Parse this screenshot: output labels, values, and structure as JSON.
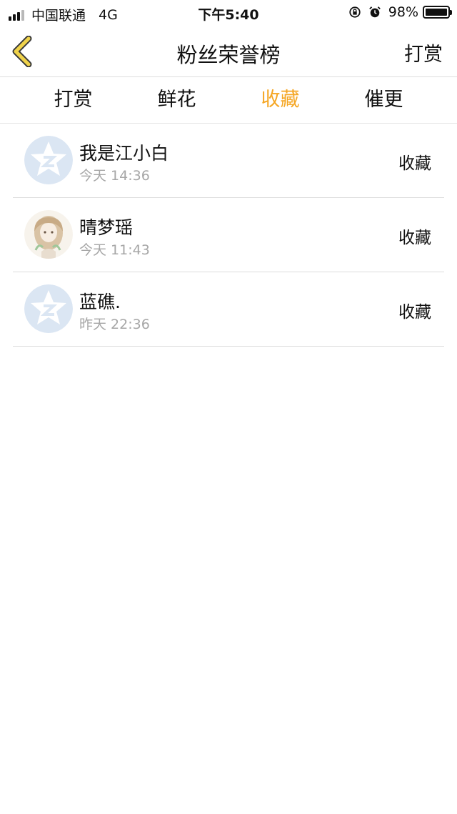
{
  "status_bar": {
    "carrier": "中国联通",
    "network": "4G",
    "time": "下午5:40",
    "battery": "98%",
    "icons": [
      "signal-icon",
      "rotation-lock-icon",
      "alarm-icon",
      "battery-icon"
    ]
  },
  "nav": {
    "title": "粉丝荣誉榜",
    "right_action": "打赏",
    "back_icon": "chevron-left-icon"
  },
  "tabs": [
    {
      "label": "打赏",
      "active": false
    },
    {
      "label": "鲜花",
      "active": false
    },
    {
      "label": "收藏",
      "active": true
    },
    {
      "label": "催更",
      "active": false
    }
  ],
  "list": [
    {
      "name": "我是江小白",
      "time": "今天 14:36",
      "action": "收藏",
      "avatar": "qq-default-avatar-icon"
    },
    {
      "name": "晴梦瑶",
      "time": "今天 11:43",
      "action": "收藏",
      "avatar": "anime-girl-avatar-icon"
    },
    {
      "name": "蓝礁.",
      "time": "昨天 22:36",
      "action": "收藏",
      "avatar": "qq-default-avatar-icon"
    }
  ],
  "colors": {
    "accent": "#f5a623",
    "back_arrow": "#f0d34a",
    "avatar_default": "#dbe6f3",
    "secondary_text": "#a6a6a6"
  }
}
